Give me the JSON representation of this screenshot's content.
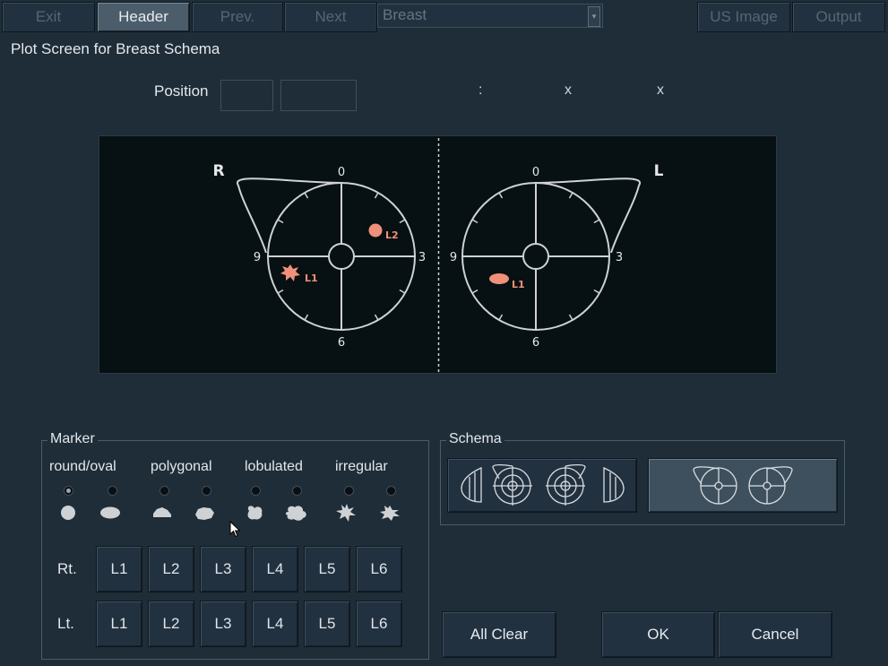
{
  "toolbar": {
    "exit": "Exit",
    "header": "Header",
    "prev": "Prev.",
    "next": "Next",
    "combo_value": "Breast",
    "us_image": "US Image",
    "output": "Output"
  },
  "screen_title": "Plot Screen for Breast Schema",
  "position": {
    "label": "Position",
    "sep": ":",
    "x1": "x",
    "x2": "x"
  },
  "schema_view": {
    "right_side": "R",
    "left_side": "L",
    "clock": {
      "top": "0",
      "right": "3",
      "bottom": "6",
      "left": "9"
    },
    "lesions": [
      {
        "side": "right",
        "label": "L2",
        "shape": "round/oval"
      },
      {
        "side": "right",
        "label": "L1",
        "shape": "irregular"
      },
      {
        "side": "left",
        "label": "L1",
        "shape": "round/oval"
      }
    ],
    "lesion_color": "#f0907a"
  },
  "marker": {
    "title": "Marker",
    "shapes": [
      "round/oval",
      "polygonal",
      "lobulated",
      "irregular"
    ],
    "selected_radio": 0,
    "rt_label": "Rt.",
    "lt_label": "Lt.",
    "lesion_buttons": [
      "L1",
      "L2",
      "L3",
      "L4",
      "L5",
      "L6"
    ]
  },
  "schema": {
    "title": "Schema"
  },
  "actions": {
    "all_clear": "All Clear",
    "ok": "OK",
    "cancel": "Cancel"
  }
}
